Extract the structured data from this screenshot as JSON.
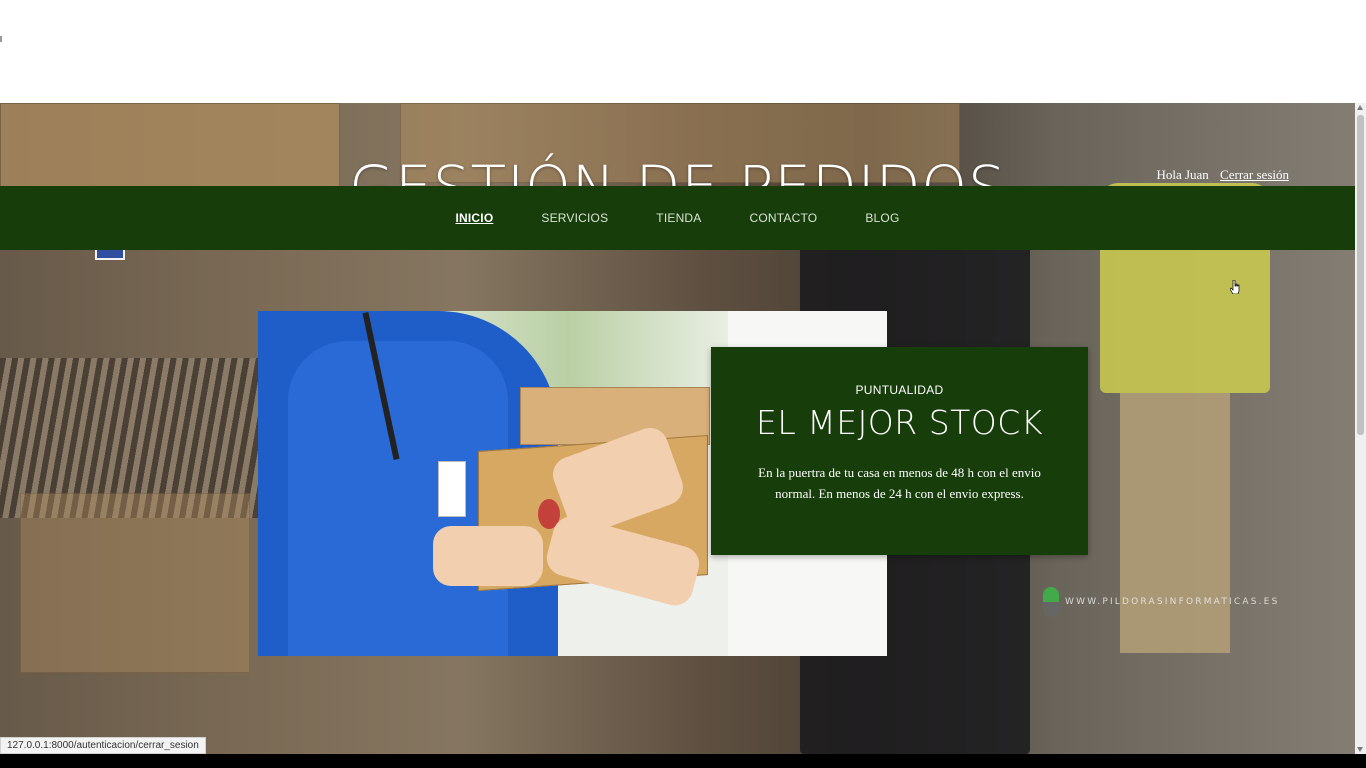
{
  "site": {
    "title": "GESTIÓN DE PEDIDOS"
  },
  "user": {
    "greeting": "Hola Juan",
    "logout_label": "Cerrar sesión"
  },
  "nav": {
    "items": [
      {
        "label": "INICIO",
        "active": true
      },
      {
        "label": "SERVICIOS",
        "active": false
      },
      {
        "label": "TIENDA",
        "active": false
      },
      {
        "label": "CONTACTO",
        "active": false
      },
      {
        "label": "BLOG",
        "active": false
      }
    ]
  },
  "feature_card": {
    "kicker": "PUNTUALIDAD",
    "heading": "EL MEJOR STOCK",
    "body": "En la puertra de tu casa en menos de 48 h con el envio normal. En menos de 24 h con el envio express."
  },
  "watermark": {
    "text": "WWW.PILDORASINFORMATICAS.ES"
  },
  "status_bar": {
    "url": "127.0.0.1:8000/autenticacion/cerrar_sesion"
  },
  "colors": {
    "brand_green": "#173d0b",
    "nav_text": "#d9e4d2"
  },
  "icons": {
    "cursor": "hand-pointer-icon",
    "watermark_logo": "pill-logo-icon"
  }
}
